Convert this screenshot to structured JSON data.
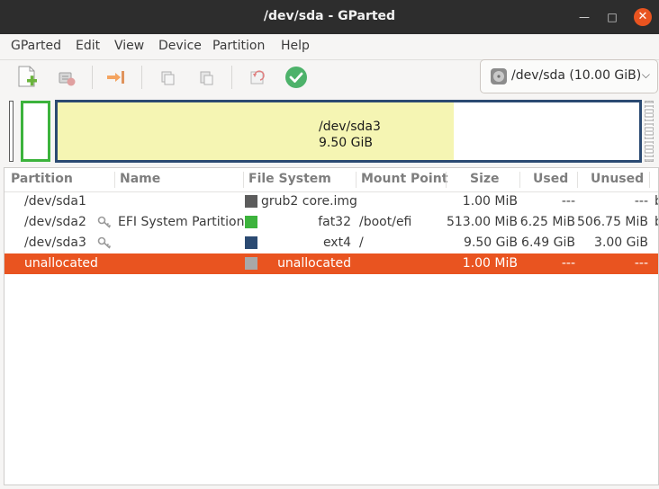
{
  "window": {
    "title": "/dev/sda - GParted"
  },
  "menubar": {
    "items": [
      "GParted",
      "Edit",
      "View",
      "Device",
      "Partition",
      "Help"
    ]
  },
  "device": {
    "label": "/dev/sda (10.00 GiB)"
  },
  "diskmap": {
    "selected_name": "/dev/sda3",
    "selected_size": "9.50 GiB"
  },
  "table": {
    "columns": [
      "Partition",
      "Name",
      "File System",
      "Mount Point",
      "Size",
      "Used",
      "Unused"
    ],
    "rows": [
      {
        "partition": "/dev/sda1",
        "name": "",
        "fs_color": "#5c5c5c",
        "filesystem": "grub2 core.img",
        "mount": "",
        "size": "1.00 MiB",
        "used": "---",
        "unused": "---",
        "flags": "b",
        "key": false,
        "selected": false
      },
      {
        "partition": "/dev/sda2",
        "name": "EFI System Partition",
        "fs_color": "#3cb33c",
        "filesystem": "fat32",
        "mount": "/boot/efi",
        "size": "513.00 MiB",
        "used": "6.25 MiB",
        "unused": "506.75 MiB",
        "flags": "b",
        "key": true,
        "selected": false
      },
      {
        "partition": "/dev/sda3",
        "name": "",
        "fs_color": "#2b4a72",
        "filesystem": "ext4",
        "mount": "/",
        "size": "9.50 GiB",
        "used": "6.49 GiB",
        "unused": "3.00 GiB",
        "flags": "",
        "key": true,
        "selected": false
      },
      {
        "partition": "unallocated",
        "name": "",
        "fs_color": "#a8a8a8",
        "filesystem": "unallocated",
        "mount": "",
        "size": "1.00 MiB",
        "used": "---",
        "unused": "---",
        "flags": "",
        "key": false,
        "selected": true
      }
    ]
  },
  "colors": {
    "accent": "#e95420",
    "ok": "#4db26a",
    "ext4": "#2b4a72",
    "fat32": "#3cb33c"
  }
}
